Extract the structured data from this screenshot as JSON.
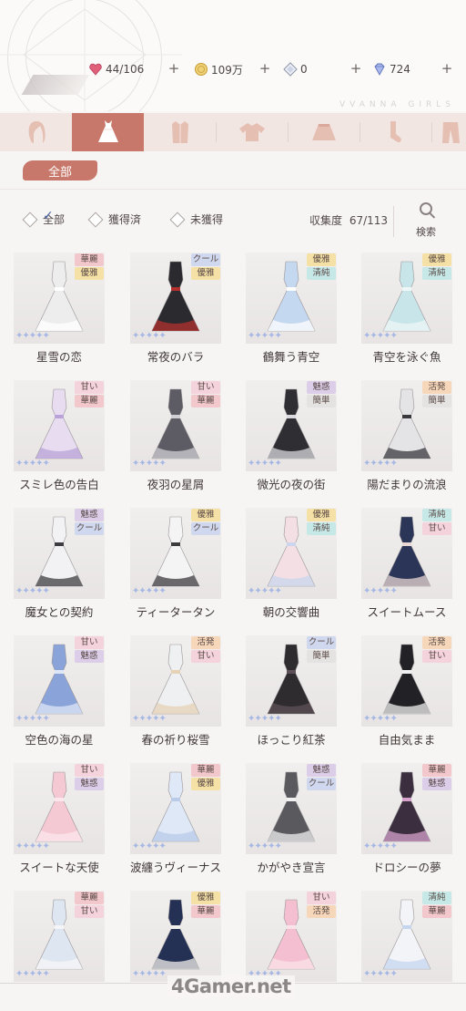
{
  "brand": "VVANNA GIRLS",
  "currencies": [
    {
      "icon": "heart-gem-icon",
      "value": "44/106"
    },
    {
      "icon": "gold-coin-icon",
      "value": "109万"
    },
    {
      "icon": "crystal-icon",
      "value": "0"
    },
    {
      "icon": "diamond-icon",
      "value": "724"
    }
  ],
  "tabs": [
    {
      "icon": "hair-icon"
    },
    {
      "icon": "dress-icon",
      "active": true
    },
    {
      "icon": "coat-icon"
    },
    {
      "icon": "top-icon"
    },
    {
      "icon": "skirt-icon"
    },
    {
      "icon": "socks-icon"
    },
    {
      "icon": "pants-icon"
    }
  ],
  "subtab": {
    "label": "全部"
  },
  "filters": {
    "all": "全部",
    "obtained": "獲得済",
    "unobtained": "未獲得",
    "collection_label": "収集度",
    "collection_value": "67/113",
    "search": "検索"
  },
  "colors": {
    "accent": "#c8786a",
    "tab_bg": "#f1e6e2",
    "stars": "#a7b7e3"
  },
  "items": [
    {
      "name": "星雪の恋",
      "tags": [
        "華麗",
        "優雅"
      ],
      "dress": "#ededed",
      "accent": "#ffffff"
    },
    {
      "name": "常夜のバラ",
      "tags": [
        "クール",
        "優雅"
      ],
      "dress": "#2b2a2e",
      "accent": "#b4302f"
    },
    {
      "name": "鶴舞う青空",
      "tags": [
        "優雅",
        "清純"
      ],
      "dress": "#c4d8ef",
      "accent": "#ffffff"
    },
    {
      "name": "青空を泳ぐ魚",
      "tags": [
        "優雅",
        "清純"
      ],
      "dress": "#c8e6ea",
      "accent": "#eef6f6"
    },
    {
      "name": "スミレ色の告白",
      "tags": [
        "甘い",
        "華麗"
      ],
      "dress": "#e7dcf0",
      "accent": "#b9a3d8"
    },
    {
      "name": "夜羽の星屑",
      "tags": [
        "甘い",
        "華麗"
      ],
      "dress": "#5d5b63",
      "accent": "#cfcfd4"
    },
    {
      "name": "微光の夜の街",
      "tags": [
        "魅惑",
        "簡単"
      ],
      "dress": "#2f2e33",
      "accent": "#d9d9dd"
    },
    {
      "name": "陽だまりの流浪",
      "tags": [
        "活発",
        "簡単"
      ],
      "dress": "#e4e3e6",
      "accent": "#3a393d"
    },
    {
      "name": "魔女との契約",
      "tags": [
        "魅惑",
        "クール"
      ],
      "dress": "#f2f2f4",
      "accent": "#3d3c40"
    },
    {
      "name": "ティータータン",
      "tags": [
        "優雅",
        "クール"
      ],
      "dress": "#f5f4f4",
      "accent": "#3b3a3d"
    },
    {
      "name": "朝の交響曲",
      "tags": [
        "優雅",
        "清純"
      ],
      "dress": "#f4dfe4",
      "accent": "#c9d6ee"
    },
    {
      "name": "スイートムース",
      "tags": [
        "清純",
        "甘い"
      ],
      "dress": "#2b3558",
      "accent": "#e8d7d2"
    },
    {
      "name": "空色の海の星",
      "tags": [
        "甘い",
        "魅惑"
      ],
      "dress": "#8aa3d9",
      "accent": "#dfe6f6"
    },
    {
      "name": "春の祈り桜雪",
      "tags": [
        "活発",
        "甘い"
      ],
      "dress": "#eef0f2",
      "accent": "#e6d2b4"
    },
    {
      "name": "ほっこり紅茶",
      "tags": [
        "クール",
        "簡単"
      ],
      "dress": "#2e2c2f",
      "accent": "#5d5058"
    },
    {
      "name": "自由気まま",
      "tags": [
        "活発",
        "甘い"
      ],
      "dress": "#222125",
      "accent": "#f1f1f2"
    },
    {
      "name": "スイートな天使",
      "tags": [
        "甘い",
        "魅惑"
      ],
      "dress": "#f5c9d3",
      "accent": "#fbe6ec"
    },
    {
      "name": "波纏うヴィーナス",
      "tags": [
        "華麗",
        "優雅"
      ],
      "dress": "#dfe8f6",
      "accent": "#b9cbe8"
    },
    {
      "name": "かがやき宣言",
      "tags": [
        "魅惑",
        "クール"
      ],
      "dress": "#5a595e",
      "accent": "#f0f0f1"
    },
    {
      "name": "ドロシーの夢",
      "tags": [
        "華麗",
        "魅惑"
      ],
      "dress": "#3b2f3f",
      "accent": "#d6a2cc"
    },
    {
      "name": "",
      "tags": [
        "華麗",
        "甘い"
      ],
      "dress": "#dde6f1",
      "accent": "#f5f5f7"
    },
    {
      "name": "",
      "tags": [
        "優雅",
        "華麗"
      ],
      "dress": "#253055",
      "accent": "#f1efe9"
    },
    {
      "name": "",
      "tags": [
        "甘い",
        "活発"
      ],
      "dress": "#f4bfd0",
      "accent": "#fbe3ea"
    },
    {
      "name": "",
      "tags": [
        "清純",
        "華麗"
      ],
      "dress": "#f3f4f7",
      "accent": "#c6d6ef"
    }
  ],
  "watermark": "4Gamer.net"
}
